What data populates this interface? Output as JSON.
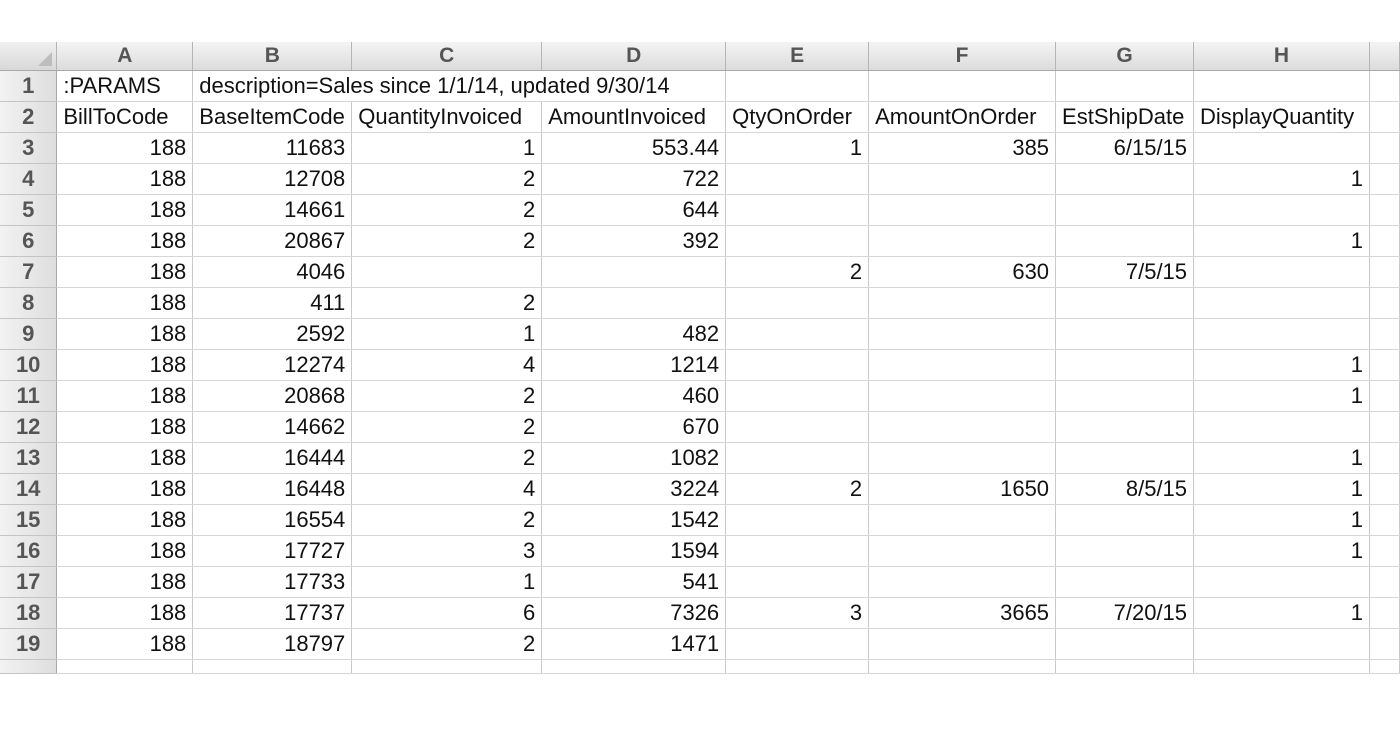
{
  "columns": [
    "A",
    "B",
    "C",
    "D",
    "E",
    "F",
    "G",
    "H"
  ],
  "rows": [
    {
      "n": "1",
      "cells": [
        ":PARAMS",
        "description=Sales since 1/1/14, updated 9/30/14",
        "",
        "",
        "",
        "",
        "",
        ""
      ]
    },
    {
      "n": "2",
      "cells": [
        "BillToCode",
        "BaseItemCode",
        "QuantityInvoiced",
        "AmountInvoiced",
        "QtyOnOrder",
        "AmountOnOrder",
        "EstShipDate",
        "DisplayQuantity"
      ]
    },
    {
      "n": "3",
      "cells": [
        "188",
        "11683",
        "1",
        "553.44",
        "1",
        "385",
        "6/15/15",
        ""
      ]
    },
    {
      "n": "4",
      "cells": [
        "188",
        "12708",
        "2",
        "722",
        "",
        "",
        "",
        "1"
      ]
    },
    {
      "n": "5",
      "cells": [
        "188",
        "14661",
        "2",
        "644",
        "",
        "",
        "",
        ""
      ]
    },
    {
      "n": "6",
      "cells": [
        "188",
        "20867",
        "2",
        "392",
        "",
        "",
        "",
        "1"
      ]
    },
    {
      "n": "7",
      "cells": [
        "188",
        "4046",
        "",
        "",
        "2",
        "630",
        "7/5/15",
        ""
      ]
    },
    {
      "n": "8",
      "cells": [
        "188",
        "411",
        "2",
        "",
        "",
        "",
        "",
        ""
      ]
    },
    {
      "n": "9",
      "cells": [
        "188",
        "2592",
        "1",
        "482",
        "",
        "",
        "",
        ""
      ]
    },
    {
      "n": "10",
      "cells": [
        "188",
        "12274",
        "4",
        "1214",
        "",
        "",
        "",
        "1"
      ]
    },
    {
      "n": "11",
      "cells": [
        "188",
        "20868",
        "2",
        "460",
        "",
        "",
        "",
        "1"
      ]
    },
    {
      "n": "12",
      "cells": [
        "188",
        "14662",
        "2",
        "670",
        "",
        "",
        "",
        ""
      ]
    },
    {
      "n": "13",
      "cells": [
        "188",
        "16444",
        "2",
        "1082",
        "",
        "",
        "",
        "1"
      ]
    },
    {
      "n": "14",
      "cells": [
        "188",
        "16448",
        "4",
        "3224",
        "2",
        "1650",
        "8/5/15",
        "1"
      ]
    },
    {
      "n": "15",
      "cells": [
        "188",
        "16554",
        "2",
        "1542",
        "",
        "",
        "",
        "1"
      ]
    },
    {
      "n": "16",
      "cells": [
        "188",
        "17727",
        "3",
        "1594",
        "",
        "",
        "",
        "1"
      ]
    },
    {
      "n": "17",
      "cells": [
        "188",
        "17733",
        "1",
        "541",
        "",
        "",
        "",
        ""
      ]
    },
    {
      "n": "18",
      "cells": [
        "188",
        "17737",
        "6",
        "7326",
        "3",
        "3665",
        "7/20/15",
        "1"
      ]
    },
    {
      "n": "19",
      "cells": [
        "188",
        "18797",
        "2",
        "1471",
        "",
        "",
        "",
        ""
      ]
    }
  ],
  "colors": {
    "header_bg": "#dcdcdc",
    "grid_line": "#d6d6d6",
    "header_text": "#555555"
  }
}
